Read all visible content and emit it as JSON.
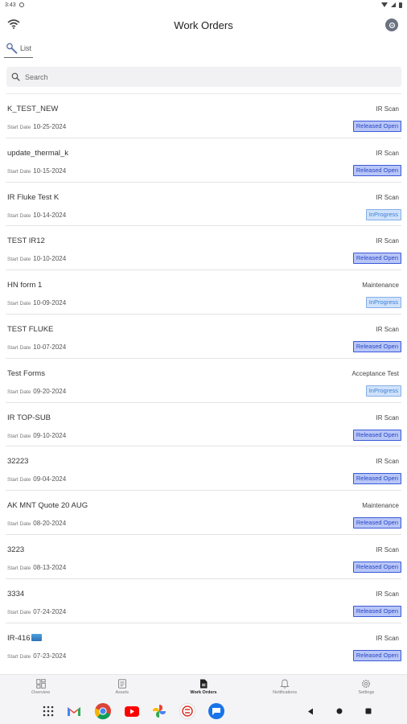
{
  "status_bar": {
    "time": "3:43"
  },
  "header": {
    "title": "Work Orders"
  },
  "tabs": [
    {
      "label": "List"
    }
  ],
  "search": {
    "placeholder": "Search"
  },
  "work_orders": [
    {
      "name": "K_TEST_NEW",
      "type": "IR Scan",
      "date_label": "Start Date",
      "date": "10-25-2024",
      "status": "Released Open"
    },
    {
      "name": "update_thermal_k",
      "type": "IR Scan",
      "date_label": "Start Date",
      "date": "10-15-2024",
      "status": "Released Open"
    },
    {
      "name": "IR Fluke Test K",
      "type": "IR Scan",
      "date_label": "Start Date",
      "date": "10-14-2024",
      "status": "InProgress"
    },
    {
      "name": "TEST IR12",
      "type": "IR Scan",
      "date_label": "Start Date",
      "date": "10-10-2024",
      "status": "Released Open"
    },
    {
      "name": "HN form 1",
      "type": "Maintenance",
      "date_label": "Start Date",
      "date": "10-09-2024",
      "status": "InProgress"
    },
    {
      "name": "TEST FLUKE",
      "type": "IR Scan",
      "date_label": "Start Date",
      "date": "10-07-2024",
      "status": "Released Open"
    },
    {
      "name": "Test Forms",
      "type": "Acceptance Test",
      "date_label": "Start Date",
      "date": "09-20-2024",
      "status": "InProgress"
    },
    {
      "name": "IR TOP-SUB",
      "type": "IR Scan",
      "date_label": "Start Date",
      "date": "09-10-2024",
      "status": "Released Open"
    },
    {
      "name": "32223",
      "type": "IR Scan",
      "date_label": "Start Date",
      "date": "09-04-2024",
      "status": "Released Open"
    },
    {
      "name": "AK MNT Quote 20 AUG",
      "type": "Maintenance",
      "date_label": "Start Date",
      "date": "08-20-2024",
      "status": "Released Open"
    },
    {
      "name": "3223",
      "type": "IR Scan",
      "date_label": "Start Date",
      "date": "08-13-2024",
      "status": "Released Open"
    },
    {
      "name": "3334",
      "type": "IR Scan",
      "date_label": "Start Date",
      "date": "07-24-2024",
      "status": "Released Open"
    },
    {
      "name": "IR-416",
      "type": "IR Scan",
      "date_label": "Start Date",
      "date": "07-23-2024",
      "status": "Released Open",
      "has_image_badge": true
    }
  ],
  "bottom_nav": [
    {
      "label": "Overview",
      "icon": "dashboard-icon",
      "active": false
    },
    {
      "label": "Assets",
      "icon": "assets-icon",
      "active": false
    },
    {
      "label": "Work Orders",
      "icon": "document-icon",
      "active": true
    },
    {
      "label": "Notifications",
      "icon": "bell-icon",
      "active": false
    },
    {
      "label": "Settings",
      "icon": "gear-icon",
      "active": false
    }
  ],
  "system_apps": [
    "apps-grid-icon",
    "gmail-icon",
    "chrome-icon",
    "youtube-icon",
    "photos-icon",
    "app-icon",
    "messages-icon"
  ],
  "colors": {
    "released_bg": "#b8c6f7",
    "released_border": "#3a5ad8",
    "inprogress_bg": "#cfe2fb",
    "inprogress_border": "#86aee6"
  }
}
